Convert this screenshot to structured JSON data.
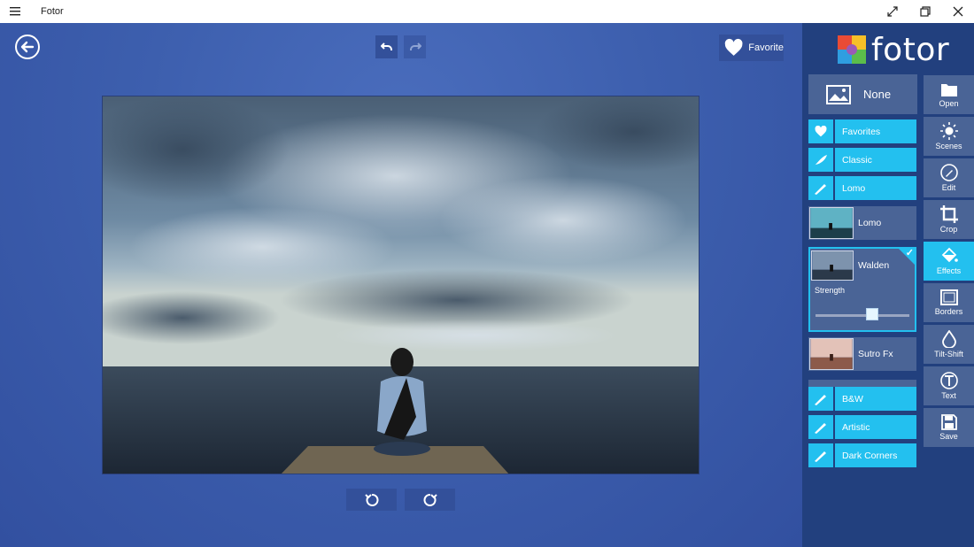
{
  "app": {
    "title": "Fotor"
  },
  "canvas": {
    "favorite_label": "Favorite"
  },
  "panel": {
    "logo_text": "fotor",
    "none_label": "None",
    "effects": [
      {
        "label": "Favorites",
        "icon": "heart-icon"
      },
      {
        "label": "Classic",
        "icon": "feather-icon"
      },
      {
        "label": "Lomo",
        "icon": "brush-icon"
      },
      {
        "label": "Lomo",
        "icon": "lomo-thumbnail"
      },
      {
        "label": "Walden",
        "icon": "walden-thumbnail",
        "selected": true,
        "strength_label": "Strength",
        "strength": 0.62
      },
      {
        "label": "Sutro Fx",
        "icon": "sutro-thumbnail"
      },
      {
        "label": "B&W",
        "icon": "brush-icon"
      },
      {
        "label": "Artistic",
        "icon": "brush-icon"
      },
      {
        "label": "Dark Corners",
        "icon": "brush-icon"
      }
    ],
    "tools": [
      {
        "label": "Open",
        "icon": "folder-icon"
      },
      {
        "label": "Scenes",
        "icon": "sun-icon"
      },
      {
        "label": "Edit",
        "icon": "pencil-icon"
      },
      {
        "label": "Crop",
        "icon": "crop-icon"
      },
      {
        "label": "Effects",
        "icon": "paint-bucket-icon",
        "active": true
      },
      {
        "label": "Borders",
        "icon": "border-icon"
      },
      {
        "label": "Tilt-Shift",
        "icon": "drop-icon"
      },
      {
        "label": "Text",
        "icon": "text-icon"
      },
      {
        "label": "Save",
        "icon": "save-icon"
      }
    ]
  },
  "colors": {
    "accent": "#23c0ef",
    "panel_bg": "#22407e",
    "canvas_bg": "#3d5fae",
    "tile_bg": "#4a6496"
  }
}
